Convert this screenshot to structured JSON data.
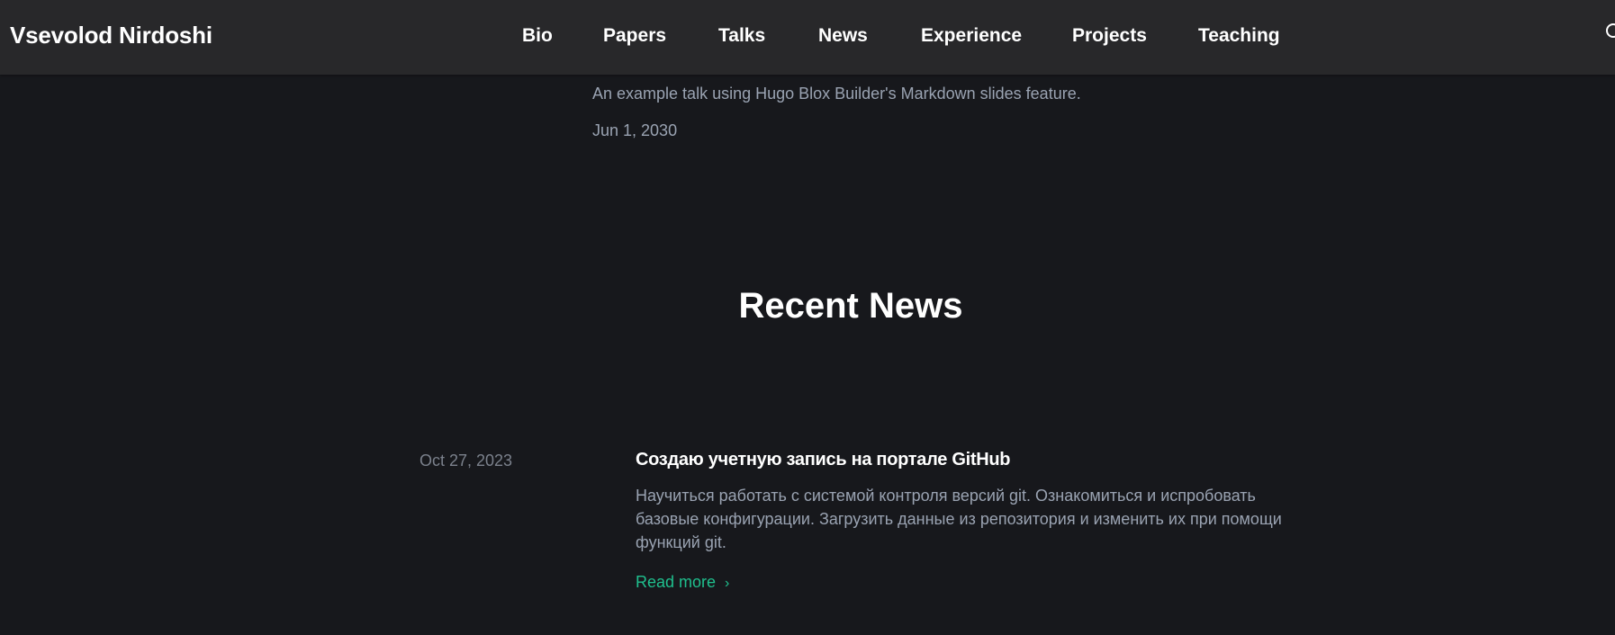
{
  "navbar": {
    "brand": "Vsevolod Nirdoshi",
    "items": [
      {
        "label": "Bio"
      },
      {
        "label": "Papers"
      },
      {
        "label": "Talks"
      },
      {
        "label": "News"
      },
      {
        "label": "Experience"
      },
      {
        "label": "Projects"
      },
      {
        "label": "Teaching"
      }
    ],
    "search_icon": "search-icon"
  },
  "talk": {
    "summary": "An example talk using Hugo Blox Builder's Markdown slides feature.",
    "date": "Jun 1, 2030"
  },
  "news_section": {
    "title": "Recent News",
    "items": [
      {
        "date": "Oct 27, 2023",
        "title": "Создаю учетную запись на портале GitHub",
        "summary": "Научиться работать с системой контроля версий git. Ознакомиться и испробовать базовые конфигурации. Загрузить данные из репозитория и изменить их при помощи функций git.",
        "read_more": "Read more",
        "read_more_icon": "›"
      }
    ]
  },
  "colors": {
    "background": "#17181c",
    "navbar": "#28282a",
    "accent": "#1fc08e",
    "muted_text": "#9aa3b2"
  }
}
